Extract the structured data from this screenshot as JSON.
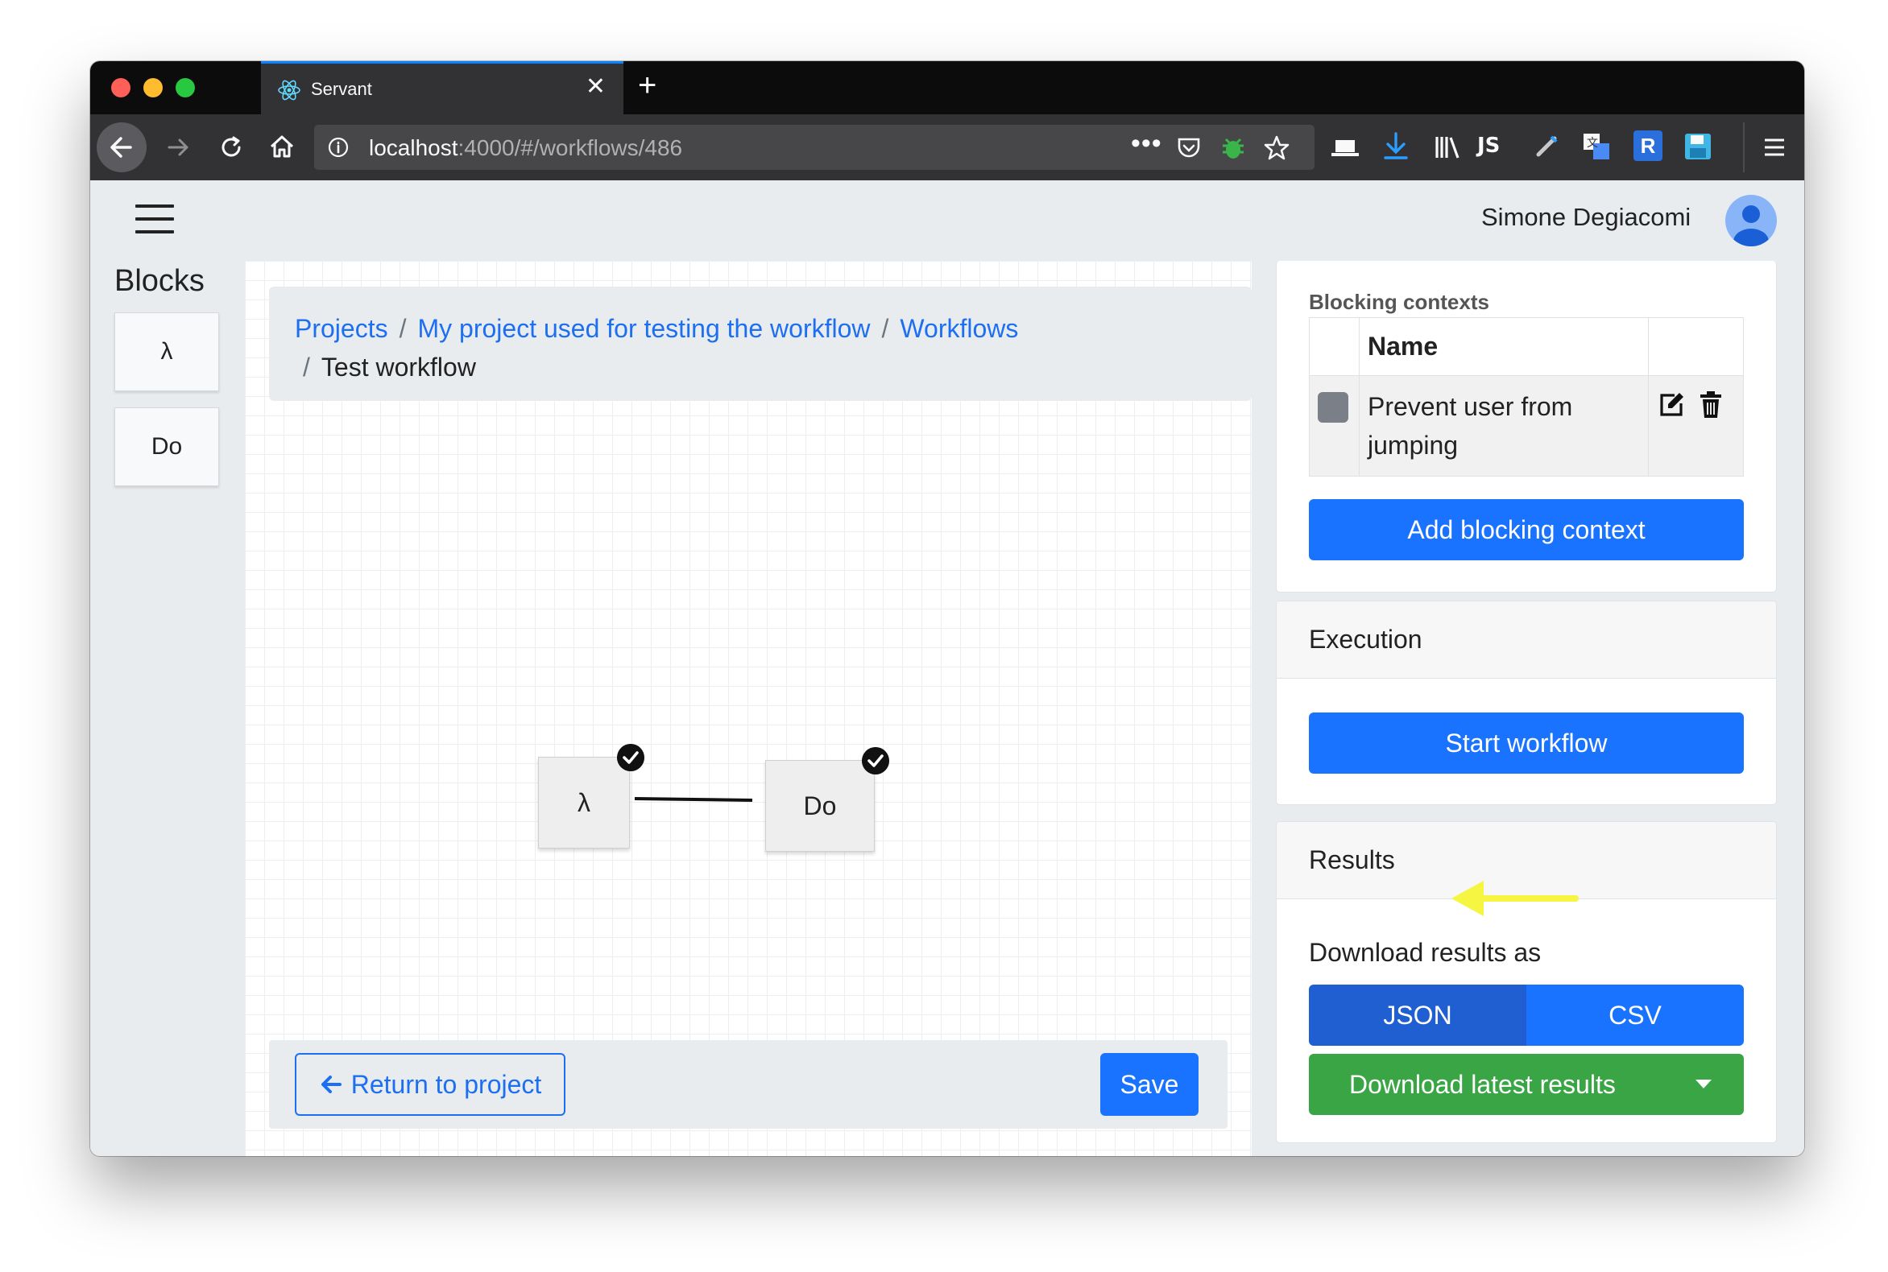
{
  "browser": {
    "tab_title": "Servant",
    "url_host": "localhost",
    "url_rest": ":4000/#/workflows/486"
  },
  "header": {
    "user_name": "Simone Degiacomi"
  },
  "blocks": {
    "title": "Blocks",
    "items": [
      "λ",
      "Do"
    ]
  },
  "breadcrumb": {
    "items": [
      "Projects",
      "My project used for testing the workflow",
      "Workflows"
    ],
    "current": "Test workflow"
  },
  "workflow": {
    "nodes": [
      {
        "label": "λ",
        "valid": true
      },
      {
        "label": "Do",
        "valid": true
      }
    ]
  },
  "actions": {
    "return_label": "Return to project",
    "save_label": "Save"
  },
  "blocking_contexts": {
    "heading": "Blocking contexts",
    "column_name": "Name",
    "rows": [
      {
        "name": "Prevent user from jumping",
        "color": "#7a7f88"
      }
    ],
    "add_label": "Add blocking context"
  },
  "execution": {
    "heading": "Execution",
    "start_label": "Start workflow"
  },
  "results": {
    "heading": "Results",
    "download_label": "Download results as",
    "formats": [
      "JSON",
      "CSV"
    ],
    "selected_format": "JSON",
    "download_latest_label": "Download latest results"
  },
  "colors": {
    "primary": "#1a73ff",
    "success": "#39a545",
    "annotation_arrow": "#f5f542"
  }
}
